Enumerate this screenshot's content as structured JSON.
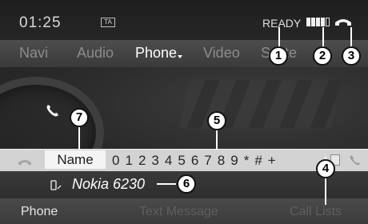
{
  "status": {
    "time": "01:25",
    "ta_label": "TA",
    "ready": "READY",
    "signal_level": 4,
    "signal_max": 5
  },
  "menu": {
    "items": [
      "Navi",
      "Audio",
      "Phone",
      "Video",
      "Syste"
    ],
    "active": "Phone"
  },
  "input_bar": {
    "name_label": "Name",
    "chars": [
      "0",
      "1",
      "2",
      "3",
      "4",
      "5",
      "6",
      "7",
      "8",
      "9",
      "*",
      "#",
      "+"
    ]
  },
  "device": {
    "name": "Nokia 6230"
  },
  "bottom": {
    "items": [
      "Phone",
      "Text Message",
      "Call Lists"
    ]
  },
  "callouts": [
    "1",
    "2",
    "3",
    "4",
    "5",
    "6",
    "7"
  ]
}
